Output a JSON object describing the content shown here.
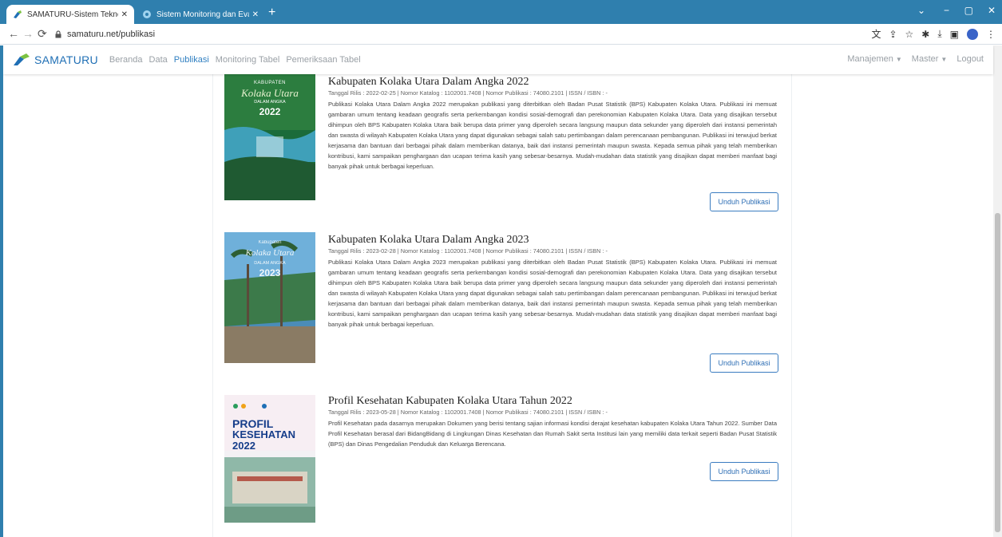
{
  "browser": {
    "tabs": [
      {
        "title": "SAMATURU-Sistem Teknologi Pe",
        "active": true
      },
      {
        "title": "Sistem Monitoring dan Evaluasi",
        "active": false
      }
    ],
    "new_tab_label": "+",
    "url": "samaturu.net/publikasi",
    "win_controls": [
      "⌄",
      "−",
      "▢",
      "✕"
    ]
  },
  "appbar": {
    "brand": "SAMATURU",
    "nav": [
      "Beranda",
      "Data",
      "Publikasi",
      "Monitoring Tabel",
      "Pemeriksaan Tabel"
    ],
    "active_nav": "Publikasi",
    "right_nav": [
      {
        "label": "Manajemen",
        "dropdown": true
      },
      {
        "label": "Master",
        "dropdown": true
      },
      {
        "label": "Logout",
        "dropdown": false
      }
    ]
  },
  "publications": [
    {
      "title": "Kabupaten Kolaka Utara Dalam Angka 2022",
      "meta": "Tanggal Rilis : 2022-02-25 | Nomor Katalog : 1102001.7408 | Nomor Publikasi : 74080.2101 | ISSN / ISBN : -",
      "description": "Publikasi Kolaka Utara Dalam Angka 2022 merupakan publikasi yang diterbitkan oleh Badan Pusat Statistik (BPS) Kabupaten Kolaka Utara. Publikasi ini memuat gambaran umum tentang keadaan geografis serta perkembangan kondisi sosial-demografi dan perekonomian Kabupaten Kolaka Utara. Data yang disajikan tersebut dihimpun oleh BPS Kabupaten Kolaka Utara baik berupa data primer yang diperoleh secara langsung maupun data sekunder yang diperoleh dari instansi pemerintah dan swasta di wilayah Kabupaten Kolaka Utara yang dapat digunakan sebagai salah satu pertimbangan dalam perencanaan pembangunan. Publikasi ini terwujud berkat kerjasama dan bantuan dari berbagai pihak dalam memberikan datanya, baik dari instansi pemerintah maupun swasta. Kepada semua pihak yang telah memberikan kontribusi, kami sampaikan penghargaan dan ucapan terima kasih yang sebesar-besarnya. Mudah-mudahan data statistik yang disajikan dapat memberi manfaat bagi banyak pihak untuk berbagai keperluan.",
      "button": "Unduh Publikasi",
      "cover_lines": [
        "KABUPATEN",
        "Kolaka Utara",
        "DALAM ANGKA",
        "2022"
      ]
    },
    {
      "title": "Kabupaten Kolaka Utara Dalam Angka 2023",
      "meta": "Tanggal Rilis : 2023-02-28 | Nomor Katalog : 1102001.7408 | Nomor Publikasi : 74080.2101 | ISSN / ISBN : -",
      "description": "Publikasi Kolaka Utara Dalam Angka 2023 merupakan publikasi yang diterbitkan oleh Badan Pusat Statistik (BPS) Kabupaten Kolaka Utara. Publikasi ini memuat gambaran umum tentang keadaan geografis serta perkembangan kondisi sosial-demografi dan perekonomian Kabupaten Kolaka Utara. Data yang disajikan tersebut dihimpun oleh BPS Kabupaten Kolaka Utara baik berupa data primer yang diperoleh secara langsung maupun data sekunder yang diperoleh dari instansi pemerintah dan swasta di wilayah Kabupaten Kolaka Utara yang dapat digunakan sebagai salah satu pertimbangan dalam perencanaan pembangunan. Publikasi ini terwujud berkat kerjasama dan bantuan dari berbagai pihak dalam memberikan datanya, baik dari instansi pemerintah maupun swasta. Kepada semua pihak yang telah memberikan kontribusi, kami sampaikan penghargaan dan ucapan terima kasih yang sebesar-besarnya. Mudah-mudahan data statistik yang disajikan dapat memberi manfaat bagi banyak pihak untuk berbagai keperluan.",
      "button": "Unduh Publikasi",
      "cover_lines": [
        "Kabupaten",
        "Kolaka Utara",
        "DALAM ANGKA",
        "2023"
      ]
    },
    {
      "title": "Profil Kesehatan Kabupaten Kolaka Utara Tahun 2022",
      "meta": "Tanggal Rilis : 2023-05-28 | Nomor Katalog : 1102001.7408 | Nomor Publikasi : 74080.2101 | ISSN / ISBN : -",
      "description": "Profil Kesehatan pada dasarnya merupakan Dokumen yang berisi tentang sajian informasi kondisi derajat kesehatan kabupaten Kolaka Utara Tahun 2022. Sumber Data Profil Kesehatan berasal dari BidangBidang di Lingkungan Dinas Kesehatan dan Rumah Sakit serta Institusi lain yang memiliki data terkait seperti Badan Pusat Statistik (BPS) dan Dinas Pengedalian Penduduk dan Keluarga Berencana.",
      "button": "Unduh Publikasi",
      "cover_lines": [
        "PROFIL",
        "KESEHATAN",
        "2022"
      ]
    }
  ],
  "colors": {
    "chrome": "#2f7fae",
    "brand": "#1f6fb5",
    "nav_active": "#2f7fc1",
    "button_border": "#3a7cc0"
  }
}
